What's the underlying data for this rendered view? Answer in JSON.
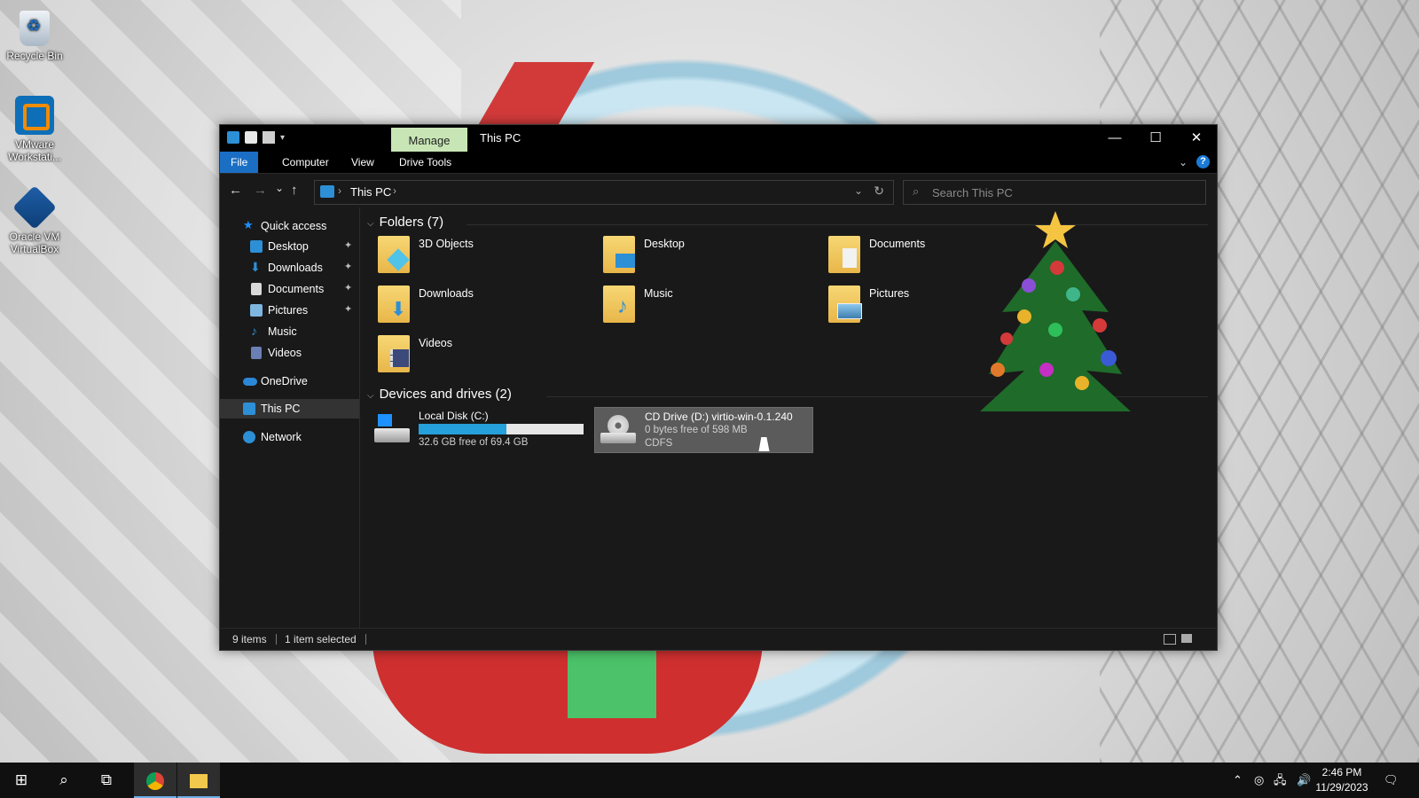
{
  "desktop": {
    "icons": [
      {
        "label": "Recycle Bin",
        "icon": "recycle-bin-icon"
      },
      {
        "label": "VMware Workstati...",
        "icon": "vmware-icon"
      },
      {
        "label": "Oracle VM VirtualBox",
        "icon": "virtualbox-icon"
      }
    ]
  },
  "window": {
    "title": "This PC",
    "contextual_tab": "Manage",
    "ribbon_tabs": [
      "File",
      "Computer",
      "View",
      "Drive Tools"
    ],
    "caption": {
      "minimize": "—",
      "maximize": "☐",
      "close": "✕"
    }
  },
  "navbar": {
    "back": "←",
    "forward": "→",
    "recent": "⌄",
    "up": "↑",
    "address": "This PC",
    "search_placeholder": "Search This PC"
  },
  "sidebar": {
    "items": [
      {
        "label": "Quick access",
        "icon": "star-icon",
        "color": "#1e90ff"
      },
      {
        "label": "Desktop",
        "icon": "desktop-icon",
        "color": "#2d8fd6",
        "pinned": true
      },
      {
        "label": "Downloads",
        "icon": "downloads-icon",
        "color": "#2d8fd6",
        "pinned": true
      },
      {
        "label": "Documents",
        "icon": "documents-icon",
        "color": "#d9d9d9",
        "pinned": true
      },
      {
        "label": "Pictures",
        "icon": "pictures-icon",
        "color": "#7fb6e0",
        "pinned": true
      },
      {
        "label": "Music",
        "icon": "music-icon",
        "color": "#2d8fd6"
      },
      {
        "label": "Videos",
        "icon": "videos-icon",
        "color": "#6a7fb3"
      },
      {
        "label": "OneDrive",
        "icon": "onedrive-icon",
        "color": "#2b88d8"
      },
      {
        "label": "This PC",
        "icon": "this-pc-icon",
        "color": "#2d8fd6",
        "selected": true
      },
      {
        "label": "Network",
        "icon": "network-icon",
        "color": "#2d8fd6"
      }
    ],
    "pin_glyph": "📌"
  },
  "content": {
    "folders_header": "Folders (7)",
    "folders": [
      {
        "label": "3D Objects",
        "icon": "3d-objects-folder-icon"
      },
      {
        "label": "Desktop",
        "icon": "desktop-folder-icon"
      },
      {
        "label": "Documents",
        "icon": "documents-folder-icon"
      },
      {
        "label": "Downloads",
        "icon": "downloads-folder-icon"
      },
      {
        "label": "Music",
        "icon": "music-folder-icon"
      },
      {
        "label": "Pictures",
        "icon": "pictures-folder-icon"
      },
      {
        "label": "Videos",
        "icon": "videos-folder-icon"
      }
    ],
    "devices_header": "Devices and drives (2)",
    "drives": [
      {
        "name": "Local Disk (C:)",
        "free": "32.6 GB free of 69.4 GB",
        "used_fraction": 0.53,
        "icon": "local-disk-icon"
      },
      {
        "name": "CD Drive (D:) virtio-win-0.1.240",
        "free": "0 bytes free of 598 MB",
        "fs": "CDFS",
        "icon": "cd-drive-icon",
        "selected": true
      }
    ]
  },
  "status": {
    "items": "9 items",
    "selected": "1 item selected"
  },
  "taskbar": {
    "time": "2:46 PM",
    "date": "11/29/2023"
  },
  "colors": {
    "accent": "#1a6fc4",
    "manage_tab": "#c8e6b5",
    "drive_bar": "#26a0da",
    "window_bg": "#191919"
  }
}
